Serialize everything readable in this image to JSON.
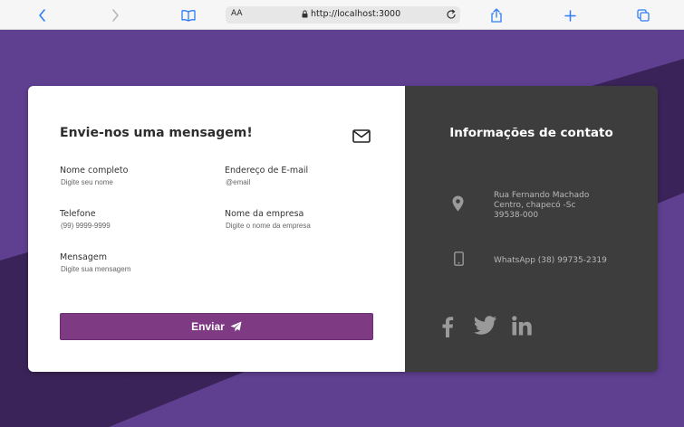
{
  "browser": {
    "text_size_label": "AA",
    "url": "http://localhost:3000"
  },
  "colors": {
    "accent": "#7e3b83",
    "info_panel": "#3d3d3d",
    "background_purple": "#5f3f90",
    "background_dark": "#3a2358"
  },
  "form": {
    "title": "Envie-nos uma mensagem!",
    "fields": [
      {
        "label": "Nome completo",
        "placeholder": "Digite seu nome"
      },
      {
        "label": "Endereço de E-mail",
        "placeholder": "@email"
      },
      {
        "label": "Telefone",
        "placeholder": "(99) 9999-9999"
      },
      {
        "label": "Nome da empresa",
        "placeholder": "Digite o nome da empresa"
      },
      {
        "label": "Mensagem",
        "placeholder": "Digite sua mensagem"
      }
    ],
    "submit_label": "Enviar"
  },
  "contact_info": {
    "title": "Informações de contato",
    "address_lines": [
      "Rua Fernando Machado",
      "Centro, chapecó -Sc",
      "39538-000"
    ],
    "whatsapp": "WhatsApp (38) 99735-2319",
    "social_icons": [
      "facebook-icon",
      "twitter-icon",
      "linkedin-icon"
    ]
  }
}
